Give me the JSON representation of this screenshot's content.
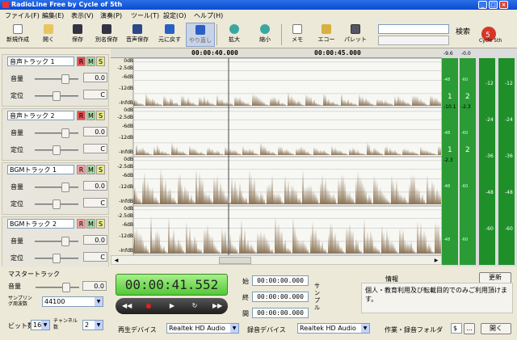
{
  "window": {
    "title": "RadioLine Free by Cycle of 5th"
  },
  "menu": [
    "ファイル(F)",
    "編集(E)",
    "表示(V)",
    "演奏(P)",
    "ツール(T)",
    "設定(O)",
    "ヘルプ(H)"
  ],
  "toolbar": {
    "buttons": [
      {
        "label": "新規作成",
        "icon": "new-file-icon"
      },
      {
        "label": "開く",
        "icon": "open-folder-icon"
      },
      {
        "label": "保存",
        "icon": "save-icon"
      },
      {
        "label": "別名保存",
        "icon": "save-as-icon"
      },
      {
        "label": "音声保存",
        "icon": "audio-save-icon"
      },
      {
        "label": "元に戻す",
        "icon": "undo-icon"
      },
      {
        "label": "やり直し",
        "icon": "redo-icon"
      },
      {
        "label": "拡大",
        "icon": "zoom-in-icon"
      },
      {
        "label": "縮小",
        "icon": "zoom-out-icon"
      },
      {
        "label": "メモ",
        "icon": "memo-icon"
      },
      {
        "label": "エコー",
        "icon": "echo-icon"
      },
      {
        "label": "パレット",
        "icon": "palette-icon"
      }
    ],
    "search_label": "検索",
    "logo_text": "Cycle 5th"
  },
  "tracks": [
    {
      "name": "音声トラック 1",
      "volume_label": "音量",
      "volume": "0.0",
      "pan_label": "定位",
      "pan": "C",
      "volume_level": 0.75,
      "pan_level": 0.5
    },
    {
      "name": "音声トラック 2",
      "volume_label": "音量",
      "volume": "0.0",
      "pan_label": "定位",
      "pan": "C",
      "volume_level": 0.75,
      "pan_level": 0.5
    },
    {
      "name": "BGMトラック 1",
      "volume_label": "音量",
      "volume": "0.0",
      "pan_label": "定位",
      "pan": "C",
      "volume_level": 0.75,
      "pan_level": 0.5
    },
    {
      "name": "BGMトラック 2",
      "volume_label": "音量",
      "volume": "0.0",
      "pan_label": "定位",
      "pan": "C",
      "volume_level": 0.75,
      "pan_level": 0.5
    }
  ],
  "track_buttons": {
    "r": "R",
    "m": "M",
    "s": "S"
  },
  "timeline": {
    "mark1": "00:00:40.000",
    "mark2": "00:00:45.000"
  },
  "db_labels": [
    "0dB",
    "-2.5dB",
    "-6dB",
    "-12dB",
    "-InfdB"
  ],
  "meters": {
    "peaks": [
      "-9.6",
      "-0.0",
      "-10.1",
      "-2.3",
      "-2.3"
    ],
    "scale_labels": [
      "-12",
      "-24",
      "-36",
      "-48",
      "-60"
    ],
    "channel_labels": [
      "1",
      "2",
      "1",
      "2"
    ],
    "small_labels": [
      "-48",
      "-60",
      "-48",
      "-60",
      "-48",
      "-60",
      "-48",
      "-60"
    ]
  },
  "master": {
    "title": "マスタートラック",
    "volume_label": "音量",
    "volume": "0.0",
    "volume_level": 0.75,
    "sample_rate_label": "サンプリング周波数",
    "sample_rate": "44100",
    "bits_label": "ビット数",
    "bits": "16",
    "channels_label": "チャンネル数",
    "channels": "2"
  },
  "transport": {
    "time": "00:00:41.552",
    "rewind": "◀◀",
    "record": "●",
    "play": "▶",
    "loop": "↻",
    "forward": "▶▶"
  },
  "range": {
    "start_label": "始",
    "start": "00:00:00.000",
    "end_label": "終",
    "end": "00:00:00.000",
    "length_label": "間",
    "length": "00:00:00.000",
    "sample_label": "サンプル"
  },
  "info": {
    "title": "情報",
    "update": "更新",
    "text": "個人・教育利用及び転載目的でのみご利用頂けます。"
  },
  "devices": {
    "playback_label": "再生デバイス",
    "playback": "Realtek HD Audio",
    "record_label": "録音デバイス",
    "record": "Realtek HD Audio",
    "folder_label": "作業・録音フォルダ",
    "folder": "$",
    "folder_more": "...",
    "open": "開く"
  },
  "colors": {
    "waveform": "#8b7355",
    "meter_green": "#1f8f2a",
    "time_green": "#6ee04e"
  }
}
